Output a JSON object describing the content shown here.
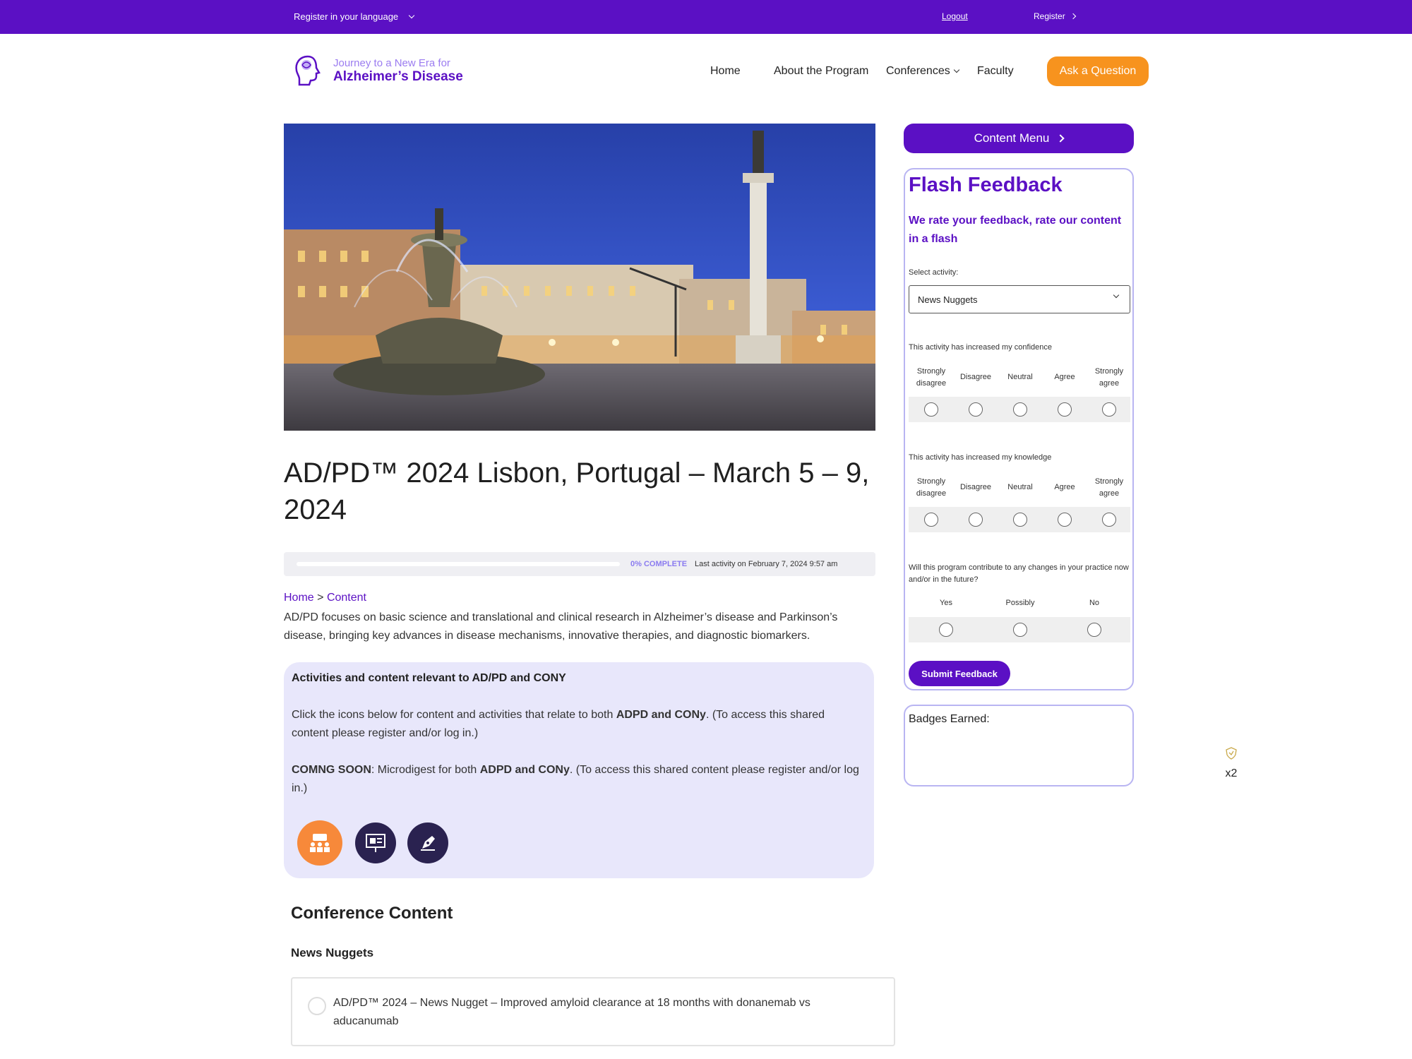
{
  "topbar": {
    "language_label": "Register in your language",
    "logout_label": "Logout",
    "register_label": "Register"
  },
  "header": {
    "logo_line1": "Journey to a New Era for",
    "logo_line2": "Alzheimer’s Disease",
    "nav": [
      "Home",
      "About the Program",
      "Conferences",
      "Faculty"
    ],
    "ask_button": "Ask a Question"
  },
  "main": {
    "title": "AD/PD™ 2024 Lisbon, Portugal – March 5 – 9, 2024",
    "progress": {
      "fraction": 0,
      "complete_label": "0% COMPLETE",
      "last_activity": "Last activity on February 7, 2024 9:57 am"
    },
    "breadcrumb": {
      "home": "Home",
      "separator": ">",
      "current": "Content"
    },
    "intro": "AD/PD focuses on basic science and translational and clinical research in Alzheimer’s disease and Parkinson’s disease, bringing key advances in disease mechanisms, innovative therapies, and diagnostic biomarkers.",
    "activities": {
      "heading": "Activities and content relevant to AD/PD and CONY",
      "p1_pre": "Click the icons below for content and activities that relate to both ",
      "p1_bold": "ADPD and CONy",
      "p1_post": ". (To access this shared content please register and/or log in.)",
      "p2_label": "COMNG SOON",
      "p2_pre": ": Microdigest for both ",
      "p2_bold": "ADPD and CONy",
      "p2_post": ". (To access this shared content please register and/or log in.)",
      "icons": [
        "audience-icon",
        "presentation-icon",
        "pen-icon"
      ]
    },
    "conference_content": "Conference Content",
    "news_nuggets_heading": "News Nuggets",
    "nuggets": [
      {
        "title": "AD/PD™ 2024 – News Nugget – Improved amyloid clearance at 18 months with donanemab vs aducanumab"
      }
    ]
  },
  "sidebar": {
    "content_menu": "Content Menu",
    "flash": {
      "title": "Flash Feedback",
      "subtitle": "We rate your feedback, rate our content in a flash",
      "select_label": "Select activity:",
      "select_value": "News Nuggets",
      "q1": "This activity has increased my confidence",
      "q2": "This activity has increased my knowledge",
      "q3": "Will this program contribute to any changes in your practice now and/or in the future?",
      "scale5": [
        "Strongly disagree",
        "Disagree",
        "Neutral",
        "Agree",
        "Strongly agree"
      ],
      "scale3": [
        "Yes",
        "Possibly",
        "No"
      ],
      "submit": "Submit Feedback"
    },
    "badges_label": "Badges Earned:",
    "badge_count": "x2"
  },
  "colors": {
    "brand_purple": "#5b10c4",
    "accent_orange": "#f7931e",
    "panel_lavender": "#e8e7fb",
    "dark_navy": "#2a2250"
  }
}
